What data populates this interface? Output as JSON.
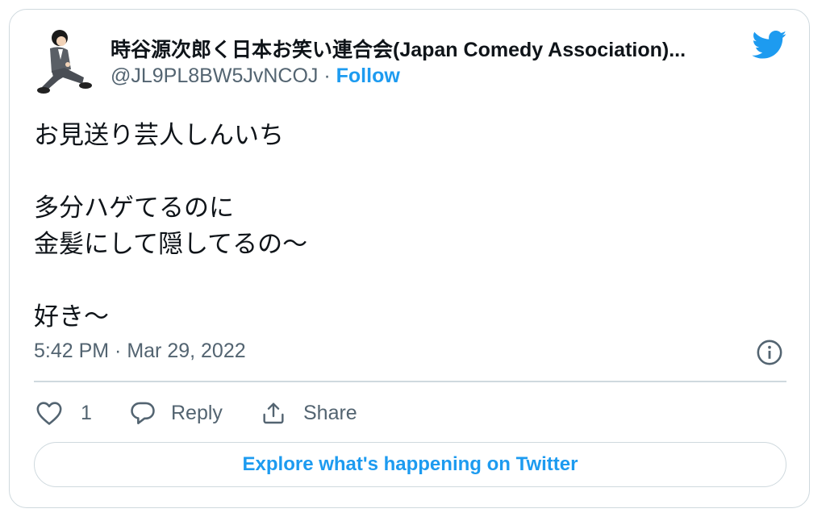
{
  "author": {
    "display_name": "時谷源次郎く日本お笑い連合会(Japan Comedy Association)...",
    "handle": "@JL9PL8BW5JvNCOJ",
    "separator": "·",
    "follow_label": "Follow"
  },
  "tweet": {
    "text": "お見送り芸人しんいち\n\n多分ハゲてるのに\n金髪にして隠してるの〜\n\n好き〜",
    "timestamp": "5:42 PM · Mar 29, 2022"
  },
  "actions": {
    "like_count": "1",
    "reply_label": "Reply",
    "share_label": "Share"
  },
  "explore_label": "Explore what's happening on Twitter",
  "colors": {
    "accent": "#1d9bf0",
    "secondary_text": "#536471",
    "border": "#cfd9de"
  },
  "icons": [
    "avatar",
    "twitter-bird-icon",
    "info-icon",
    "heart-icon",
    "reply-bubble-icon",
    "share-icon"
  ]
}
